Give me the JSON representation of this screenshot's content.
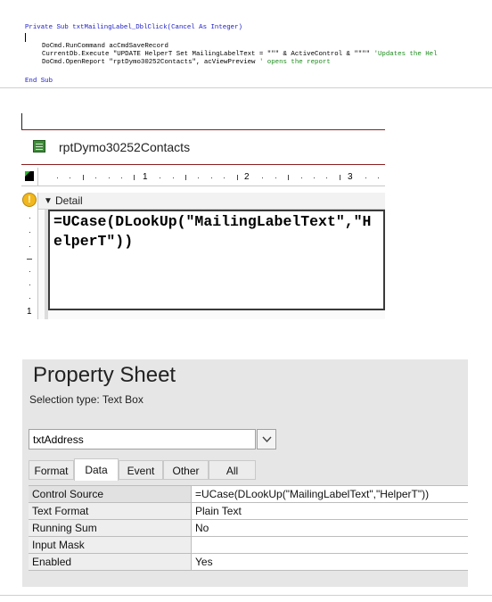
{
  "code": {
    "line1_kw": "Private Sub",
    "line1_rest": " txtMailingLabel_DblClick(Cancel As Integer)",
    "line2_a": "DoCmd.RunCommand acCmdSaveRecord",
    "line3_a": "CurrentDb.Execute \"UPDATE HelperT Set MailingLabelText = \"\"\" & ActiveControl & \"\"\"\" ",
    "line3_comment": "'Updates the Hel",
    "line4_a": "DoCmd.OpenReport \"rptDymo30252Contacts\", acViewPreview ",
    "line4_comment": "' opens the report",
    "line5_kw": "End Sub"
  },
  "report": {
    "tab_title": "rptDymo30252Contacts",
    "ruler_labels": [
      "1",
      "2",
      "3"
    ],
    "vruler_label": "1",
    "section_label": "Detail",
    "textbox_value": "=UCase(DLookUp(\"MailingLabelText\",\"HelperT\"))"
  },
  "property_sheet": {
    "title": "Property Sheet",
    "selection_type": "Selection type:  Text Box",
    "selected_object": "txtAddress",
    "tabs": [
      {
        "label": "Format"
      },
      {
        "label": "Data"
      },
      {
        "label": "Event"
      },
      {
        "label": "Other"
      },
      {
        "label": "All"
      }
    ],
    "active_tab": "Data",
    "rows": [
      {
        "name": "Control Source",
        "value": "=UCase(DLookUp(\"MailingLabelText\",\"HelperT\"))"
      },
      {
        "name": "Text Format",
        "value": "Plain Text"
      },
      {
        "name": "Running Sum",
        "value": "No"
      },
      {
        "name": "Input Mask",
        "value": ""
      },
      {
        "name": "Enabled",
        "value": "Yes"
      }
    ]
  },
  "colors": {
    "keyword": "#1b1bc7",
    "comment": "#1c8a1c",
    "warning": "#f1b71c"
  }
}
